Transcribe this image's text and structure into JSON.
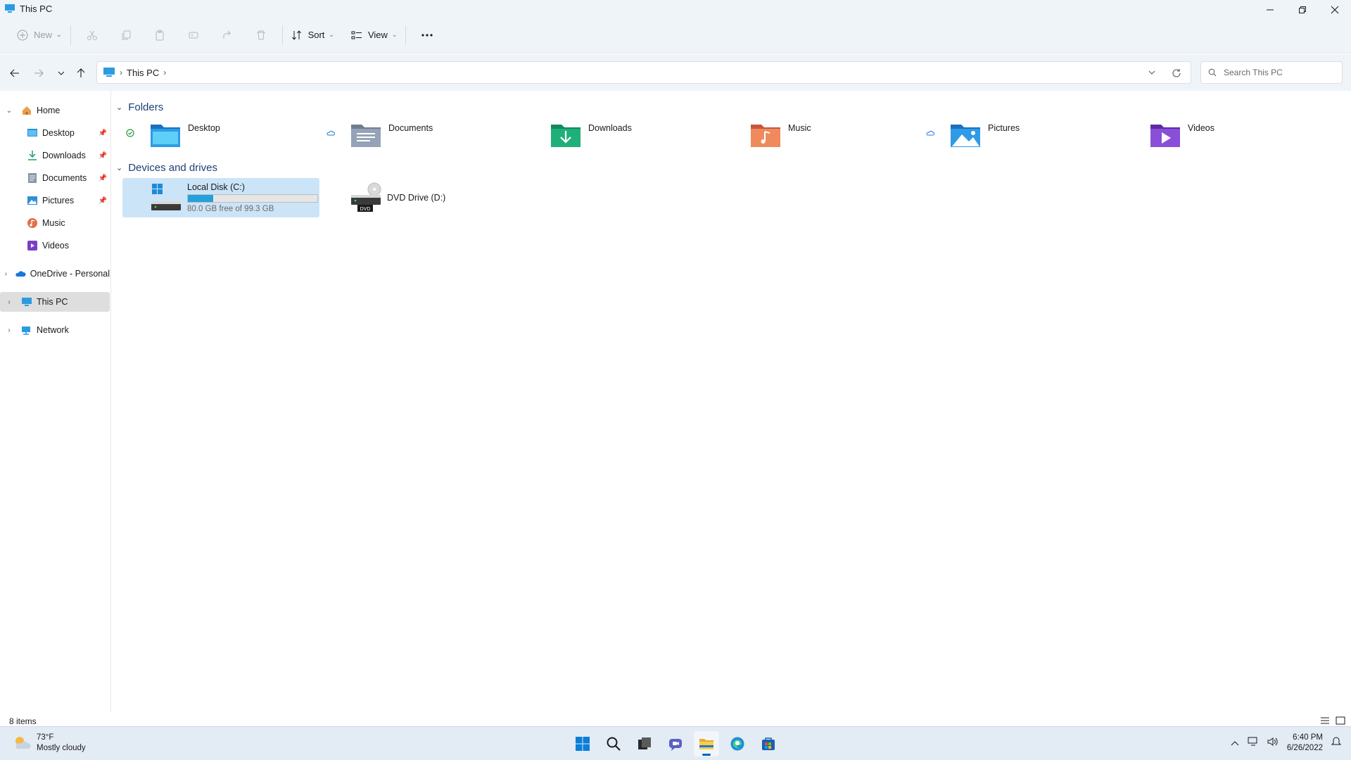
{
  "window": {
    "title": "This PC"
  },
  "toolbar": {
    "new_label": "New",
    "sort_label": "Sort",
    "view_label": "View"
  },
  "address": {
    "crumbs": [
      "This PC"
    ],
    "search_placeholder": "Search This PC"
  },
  "nav": {
    "items": [
      {
        "label": "Home",
        "icon": "home-icon",
        "expanded": true
      },
      {
        "label": "Desktop",
        "icon": "desktop-folder-icon",
        "pinned": true
      },
      {
        "label": "Downloads",
        "icon": "downloads-icon",
        "pinned": true
      },
      {
        "label": "Documents",
        "icon": "documents-icon",
        "pinned": true
      },
      {
        "label": "Pictures",
        "icon": "pictures-icon",
        "pinned": true
      },
      {
        "label": "Music",
        "icon": "music-icon"
      },
      {
        "label": "Videos",
        "icon": "videos-icon"
      },
      {
        "label": "OneDrive - Personal",
        "icon": "onedrive-icon"
      },
      {
        "label": "This PC",
        "icon": "this-pc-icon",
        "selected": true
      },
      {
        "label": "Network",
        "icon": "network-icon"
      }
    ]
  },
  "content": {
    "folders_header": "Folders",
    "folders": [
      {
        "name": "Desktop",
        "status": "synced"
      },
      {
        "name": "Documents",
        "status": "cloud"
      },
      {
        "name": "Downloads",
        "status": ""
      },
      {
        "name": "Music",
        "status": ""
      },
      {
        "name": "Pictures",
        "status": "cloud"
      },
      {
        "name": "Videos",
        "status": ""
      }
    ],
    "drives_header": "Devices and drives",
    "drives": [
      {
        "name": "Local Disk (C:)",
        "free_text": "80.0 GB free of 99.3 GB",
        "used_fraction": 0.194
      },
      {
        "name": "DVD Drive (D:)",
        "dvd_label": "DVD"
      }
    ]
  },
  "status": {
    "item_count": "8 items"
  },
  "taskbar": {
    "temperature": "73°F",
    "weather": "Mostly cloudy",
    "time": "6:40 PM",
    "date": "6/26/2022"
  },
  "colors": {
    "accent": "#0067c0",
    "selected_drive_bg": "#cce4f7",
    "drive_bar": "#26a0da",
    "section_header": "#1f3f73"
  }
}
